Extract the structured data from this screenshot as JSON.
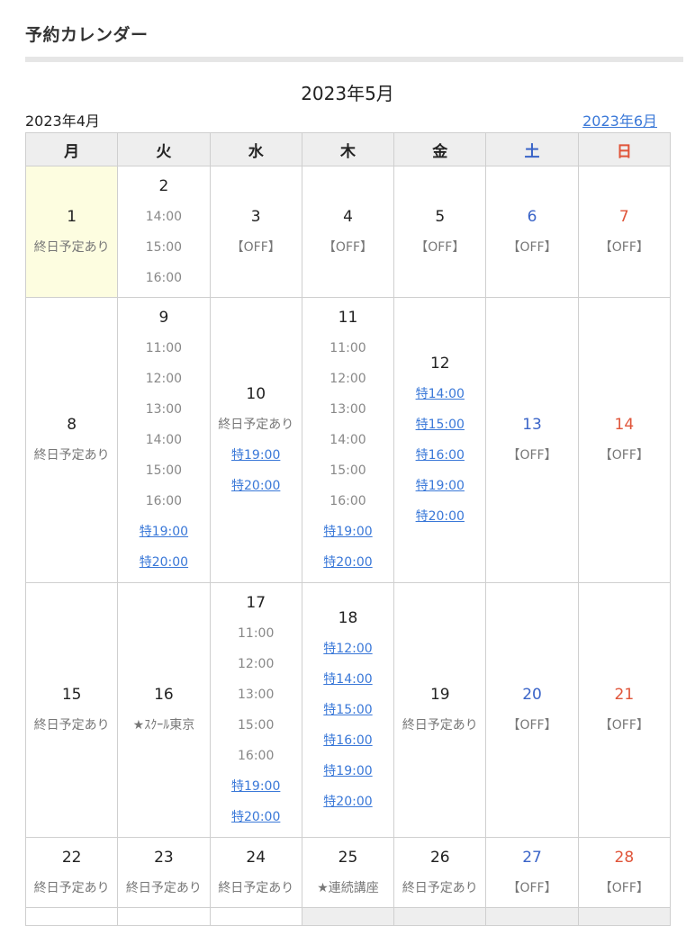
{
  "heading": "予約カレンダー",
  "month_title": "2023年5月",
  "prev_month": "2023年4月",
  "next_month": "2023年6月",
  "weekdays": [
    "月",
    "火",
    "水",
    "木",
    "金",
    "土",
    "日"
  ],
  "weeks": [
    {
      "height": 146,
      "days": [
        {
          "day": "1",
          "today": true,
          "items": [
            {
              "t": "終日予定あり",
              "kind": "text"
            }
          ]
        },
        {
          "day": "2",
          "items": [
            {
              "t": "14:00",
              "kind": "slot"
            },
            {
              "t": "15:00",
              "kind": "slot"
            },
            {
              "t": "16:00",
              "kind": "slot"
            }
          ]
        },
        {
          "day": "3",
          "items": [
            {
              "t": "【OFF】",
              "kind": "text"
            }
          ]
        },
        {
          "day": "4",
          "items": [
            {
              "t": "【OFF】",
              "kind": "text"
            }
          ]
        },
        {
          "day": "5",
          "items": [
            {
              "t": "【OFF】",
              "kind": "text"
            }
          ]
        },
        {
          "day": "6",
          "color": "sat",
          "items": [
            {
              "t": "【OFF】",
              "kind": "text"
            }
          ]
        },
        {
          "day": "7",
          "color": "sun",
          "items": [
            {
              "t": "【OFF】",
              "kind": "text"
            }
          ]
        }
      ]
    },
    {
      "height": 317,
      "days": [
        {
          "day": "8",
          "items": [
            {
              "t": "終日予定あり",
              "kind": "text"
            }
          ]
        },
        {
          "day": "9",
          "items": [
            {
              "t": "11:00",
              "kind": "slot"
            },
            {
              "t": "12:00",
              "kind": "slot"
            },
            {
              "t": "13:00",
              "kind": "slot"
            },
            {
              "t": "14:00",
              "kind": "slot"
            },
            {
              "t": "15:00",
              "kind": "slot"
            },
            {
              "t": "16:00",
              "kind": "slot"
            },
            {
              "t": "特19:00",
              "kind": "link"
            },
            {
              "t": "特20:00",
              "kind": "link"
            }
          ]
        },
        {
          "day": "10",
          "items": [
            {
              "t": "終日予定あり",
              "kind": "text"
            },
            {
              "t": "特19:00",
              "kind": "link"
            },
            {
              "t": "特20:00",
              "kind": "link"
            }
          ]
        },
        {
          "day": "11",
          "items": [
            {
              "t": "11:00",
              "kind": "slot"
            },
            {
              "t": "12:00",
              "kind": "slot"
            },
            {
              "t": "13:00",
              "kind": "slot"
            },
            {
              "t": "14:00",
              "kind": "slot"
            },
            {
              "t": "15:00",
              "kind": "slot"
            },
            {
              "t": "16:00",
              "kind": "slot"
            },
            {
              "t": "特19:00",
              "kind": "link"
            },
            {
              "t": "特20:00",
              "kind": "link"
            }
          ]
        },
        {
          "day": "12",
          "items": [
            {
              "t": "特14:00",
              "kind": "link"
            },
            {
              "t": "特15:00",
              "kind": "link"
            },
            {
              "t": "特16:00",
              "kind": "link"
            },
            {
              "t": "特19:00",
              "kind": "link"
            },
            {
              "t": "特20:00",
              "kind": "link"
            }
          ]
        },
        {
          "day": "13",
          "color": "sat",
          "items": [
            {
              "t": "【OFF】",
              "kind": "text"
            }
          ]
        },
        {
          "day": "14",
          "color": "sun",
          "items": [
            {
              "t": "【OFF】",
              "kind": "text"
            }
          ]
        }
      ]
    },
    {
      "height": 283,
      "days": [
        {
          "day": "15",
          "items": [
            {
              "t": "終日予定あり",
              "kind": "text"
            }
          ]
        },
        {
          "day": "16",
          "items": [
            {
              "t": "★ｽｸｰﾙ東京",
              "kind": "text"
            }
          ]
        },
        {
          "day": "17",
          "items": [
            {
              "t": "11:00",
              "kind": "slot"
            },
            {
              "t": "12:00",
              "kind": "slot"
            },
            {
              "t": "13:00",
              "kind": "slot"
            },
            {
              "t": "15:00",
              "kind": "slot"
            },
            {
              "t": "16:00",
              "kind": "slot"
            },
            {
              "t": "特19:00",
              "kind": "link"
            },
            {
              "t": "特20:00",
              "kind": "link"
            }
          ]
        },
        {
          "day": "18",
          "items": [
            {
              "t": "特12:00",
              "kind": "link"
            },
            {
              "t": "特14:00",
              "kind": "link"
            },
            {
              "t": "特15:00",
              "kind": "link"
            },
            {
              "t": "特16:00",
              "kind": "link"
            },
            {
              "t": "特19:00",
              "kind": "link"
            },
            {
              "t": "特20:00",
              "kind": "link"
            }
          ]
        },
        {
          "day": "19",
          "items": [
            {
              "t": "終日予定あり",
              "kind": "text"
            }
          ]
        },
        {
          "day": "20",
          "color": "sat",
          "items": [
            {
              "t": "【OFF】",
              "kind": "text"
            }
          ]
        },
        {
          "day": "21",
          "color": "sun",
          "items": [
            {
              "t": "【OFF】",
              "kind": "text"
            }
          ]
        }
      ]
    },
    {
      "height": 78,
      "days": [
        {
          "day": "22",
          "items": [
            {
              "t": "終日予定あり",
              "kind": "text"
            }
          ]
        },
        {
          "day": "23",
          "items": [
            {
              "t": "終日予定あり",
              "kind": "text"
            }
          ]
        },
        {
          "day": "24",
          "items": [
            {
              "t": "終日予定あり",
              "kind": "text"
            }
          ]
        },
        {
          "day": "25",
          "items": [
            {
              "t": "★連続講座",
              "kind": "text"
            }
          ]
        },
        {
          "day": "26",
          "items": [
            {
              "t": "終日予定あり",
              "kind": "text"
            }
          ]
        },
        {
          "day": "27",
          "color": "sat",
          "items": [
            {
              "t": "【OFF】",
              "kind": "text"
            }
          ]
        },
        {
          "day": "28",
          "color": "sun",
          "items": [
            {
              "t": "【OFF】",
              "kind": "text"
            }
          ]
        }
      ]
    },
    {
      "height": 20,
      "days": [
        {
          "day": "",
          "items": []
        },
        {
          "day": "",
          "items": []
        },
        {
          "day": "",
          "items": []
        },
        {
          "day": "",
          "filler": true,
          "items": []
        },
        {
          "day": "",
          "filler": true,
          "items": []
        },
        {
          "day": "",
          "filler": true,
          "items": []
        },
        {
          "day": "",
          "filler": true,
          "items": []
        }
      ]
    }
  ]
}
